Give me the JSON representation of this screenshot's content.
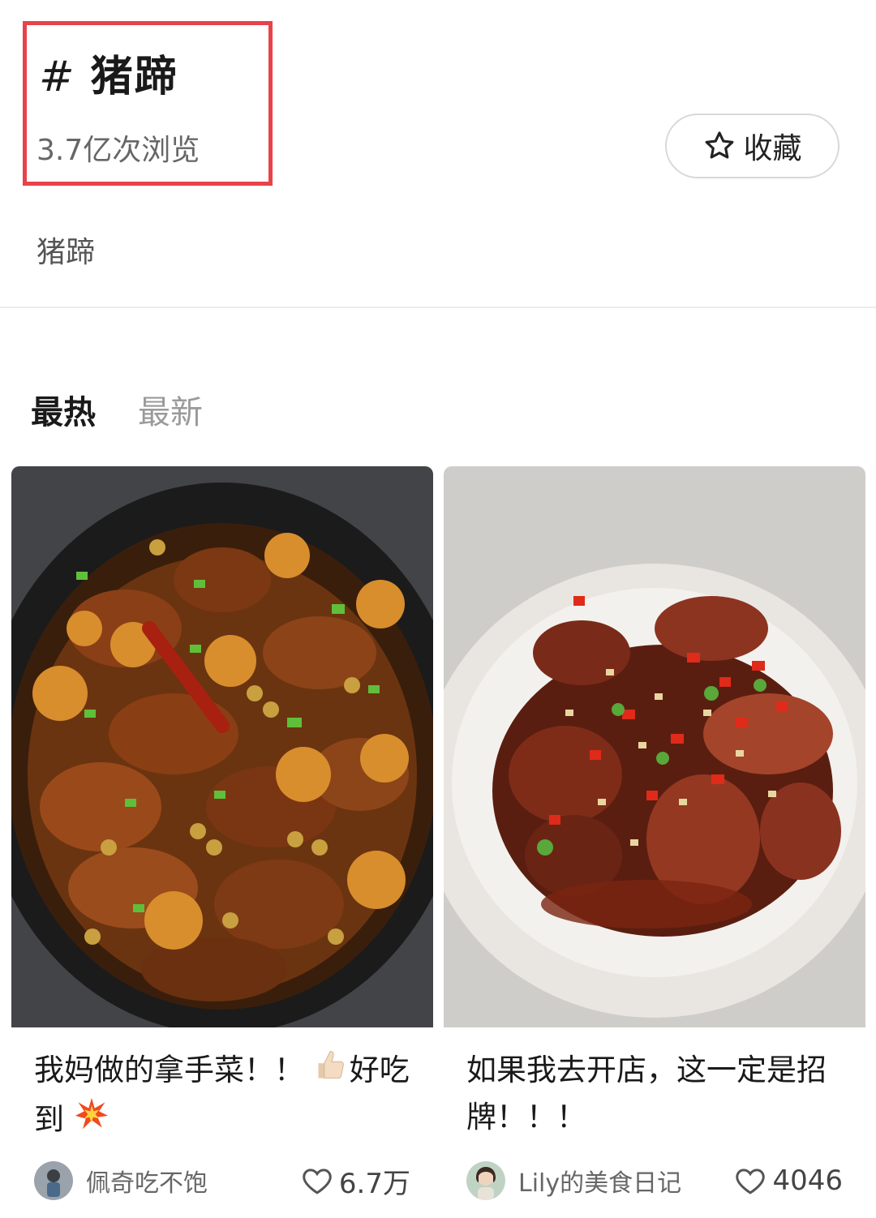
{
  "topic": {
    "hash_symbol": "#",
    "title": "猪蹄",
    "views": "3.7亿次浏览",
    "favorite_label": "收藏",
    "description": "猪蹄"
  },
  "tabs": [
    {
      "label": "最热",
      "active": true
    },
    {
      "label": "最新",
      "active": false
    }
  ],
  "posts": [
    {
      "title_part1": "我妈做的拿手菜！！",
      "title_emoji1": "thumbs-up",
      "title_part2": "好吃到",
      "title_emoji2": "collision",
      "author": "佩奇吃不饱",
      "likes": "6.7万"
    },
    {
      "title": "如果我去开店，这一定是招牌！！！",
      "author": "Lily的美食日记",
      "likes": "4046"
    }
  ],
  "colors": {
    "highlight_border": "#e8424a",
    "text_primary": "#1a1a1a",
    "text_secondary": "#666666",
    "tab_inactive": "#9a9a9a"
  }
}
